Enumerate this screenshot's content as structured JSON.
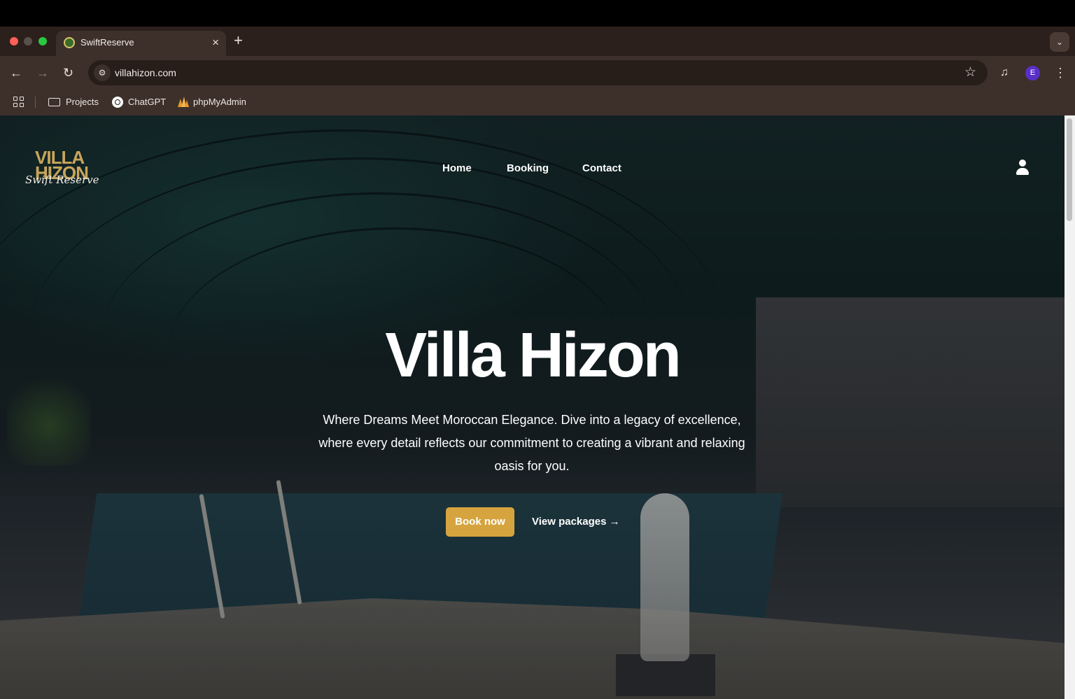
{
  "browser": {
    "tab_title": "SwiftReserve",
    "tab_close": "×",
    "new_tab": "+",
    "tab_menu": "⌄",
    "url": "villahizon.com",
    "profile_initial": "E",
    "bookmarks": [
      {
        "label": "Projects"
      },
      {
        "label": "ChatGPT"
      },
      {
        "label": "phpMyAdmin"
      }
    ]
  },
  "site": {
    "logo": {
      "line1": "VILLA",
      "line2": "HIZON",
      "script": "Swift Reserve"
    },
    "nav": [
      {
        "label": "Home"
      },
      {
        "label": "Booking"
      },
      {
        "label": "Contact"
      }
    ],
    "hero": {
      "title": "Villa Hizon",
      "subtitle": "Where Dreams Meet Moroccan Elegance. Dive into a legacy of excellence, where every detail reflects our commitment to creating a vibrant and relaxing oasis for you.",
      "primary_cta": "Book now",
      "secondary_cta": "View packages →"
    }
  },
  "colors": {
    "accent": "#d6a43e",
    "logo_gold": "#c8a55b",
    "browser_chrome": "#3d302a"
  }
}
